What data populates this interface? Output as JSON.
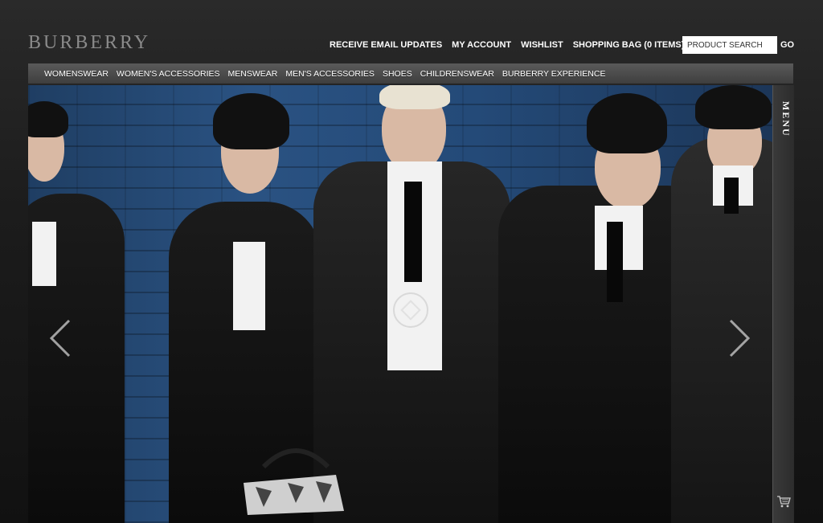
{
  "header": {
    "logo": "BURBERRY",
    "links": [
      {
        "label": "RECEIVE EMAIL UPDATES"
      },
      {
        "label": "MY ACCOUNT"
      },
      {
        "label": "WISHLIST"
      },
      {
        "label": "SHOPPING BAG (0 ITEMS)"
      }
    ],
    "search": {
      "placeholder": "PRODUCT SEARCH",
      "go_label": "GO"
    }
  },
  "nav": {
    "items": [
      {
        "label": "WOMENSWEAR"
      },
      {
        "label": "WOMEN'S ACCESSORIES"
      },
      {
        "label": "MENSWEAR"
      },
      {
        "label": "MEN'S ACCESSORIES"
      },
      {
        "label": "SHOES"
      },
      {
        "label": "CHILDRENSWEAR"
      },
      {
        "label": "BURBERRY EXPERIENCE"
      }
    ]
  },
  "hero": {
    "prev_icon": "chevron-left-icon",
    "next_icon": "chevron-right-icon",
    "zoom_icon": "zoom-diamond-icon"
  },
  "side_menu": {
    "label": "MENU",
    "cart_icon": "shopping-cart-icon"
  },
  "colors": {
    "background": "#1a1a1a",
    "nav_bar": "#4a4a4a",
    "wall_blue": "#2a5282",
    "logo_gray": "#8a8a8a"
  }
}
